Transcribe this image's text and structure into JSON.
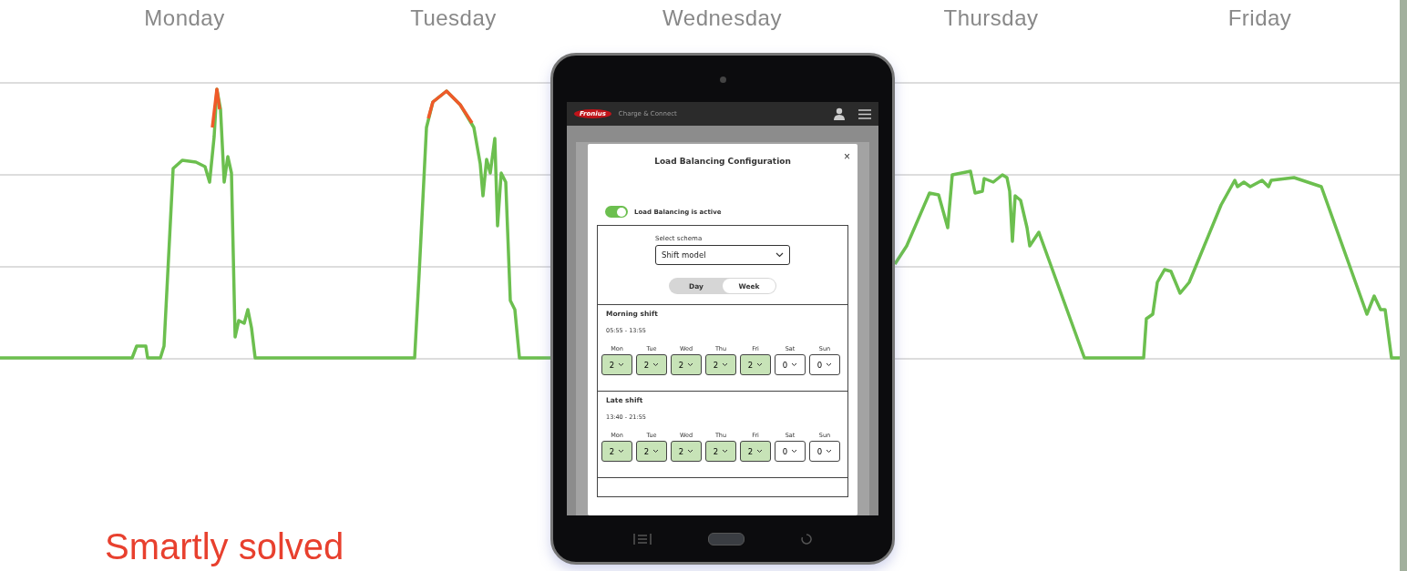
{
  "days": [
    "Monday",
    "Tuesday",
    "Wednesday",
    "Thursday",
    "Friday"
  ],
  "app": {
    "brand": "Fronius",
    "app_name": "Charge & Connect",
    "dialog": {
      "title": "Load Balancing Configuration",
      "close": "×",
      "toggle": {
        "label": "Load Balancing is active",
        "on": true
      },
      "schema": {
        "label": "Select schema",
        "value": "Shift model"
      },
      "view_tabs": [
        {
          "label": "Day",
          "selected": false
        },
        {
          "label": "Week",
          "selected": true
        }
      ],
      "shifts": [
        {
          "name": "Morning shift",
          "time": "05:55 - 13:55",
          "days": [
            {
              "day": "Mon",
              "value": "2",
              "active": true
            },
            {
              "day": "Tue",
              "value": "2",
              "active": true
            },
            {
              "day": "Wed",
              "value": "2",
              "active": true
            },
            {
              "day": "Thu",
              "value": "2",
              "active": true
            },
            {
              "day": "Fri",
              "value": "2",
              "active": true
            },
            {
              "day": "Sat",
              "value": "0",
              "active": false
            },
            {
              "day": "Sun",
              "value": "0",
              "active": false
            }
          ]
        },
        {
          "name": "Late shift",
          "time": "13:40 - 21:55",
          "days": [
            {
              "day": "Mon",
              "value": "2",
              "active": true
            },
            {
              "day": "Tue",
              "value": "2",
              "active": true
            },
            {
              "day": "Wed",
              "value": "2",
              "active": true
            },
            {
              "day": "Thu",
              "value": "2",
              "active": true
            },
            {
              "day": "Fri",
              "value": "2",
              "active": true
            },
            {
              "day": "Sat",
              "value": "0",
              "active": false
            },
            {
              "day": "Sun",
              "value": "0",
              "active": false
            }
          ]
        }
      ]
    }
  },
  "headline": "Smartly solved"
}
